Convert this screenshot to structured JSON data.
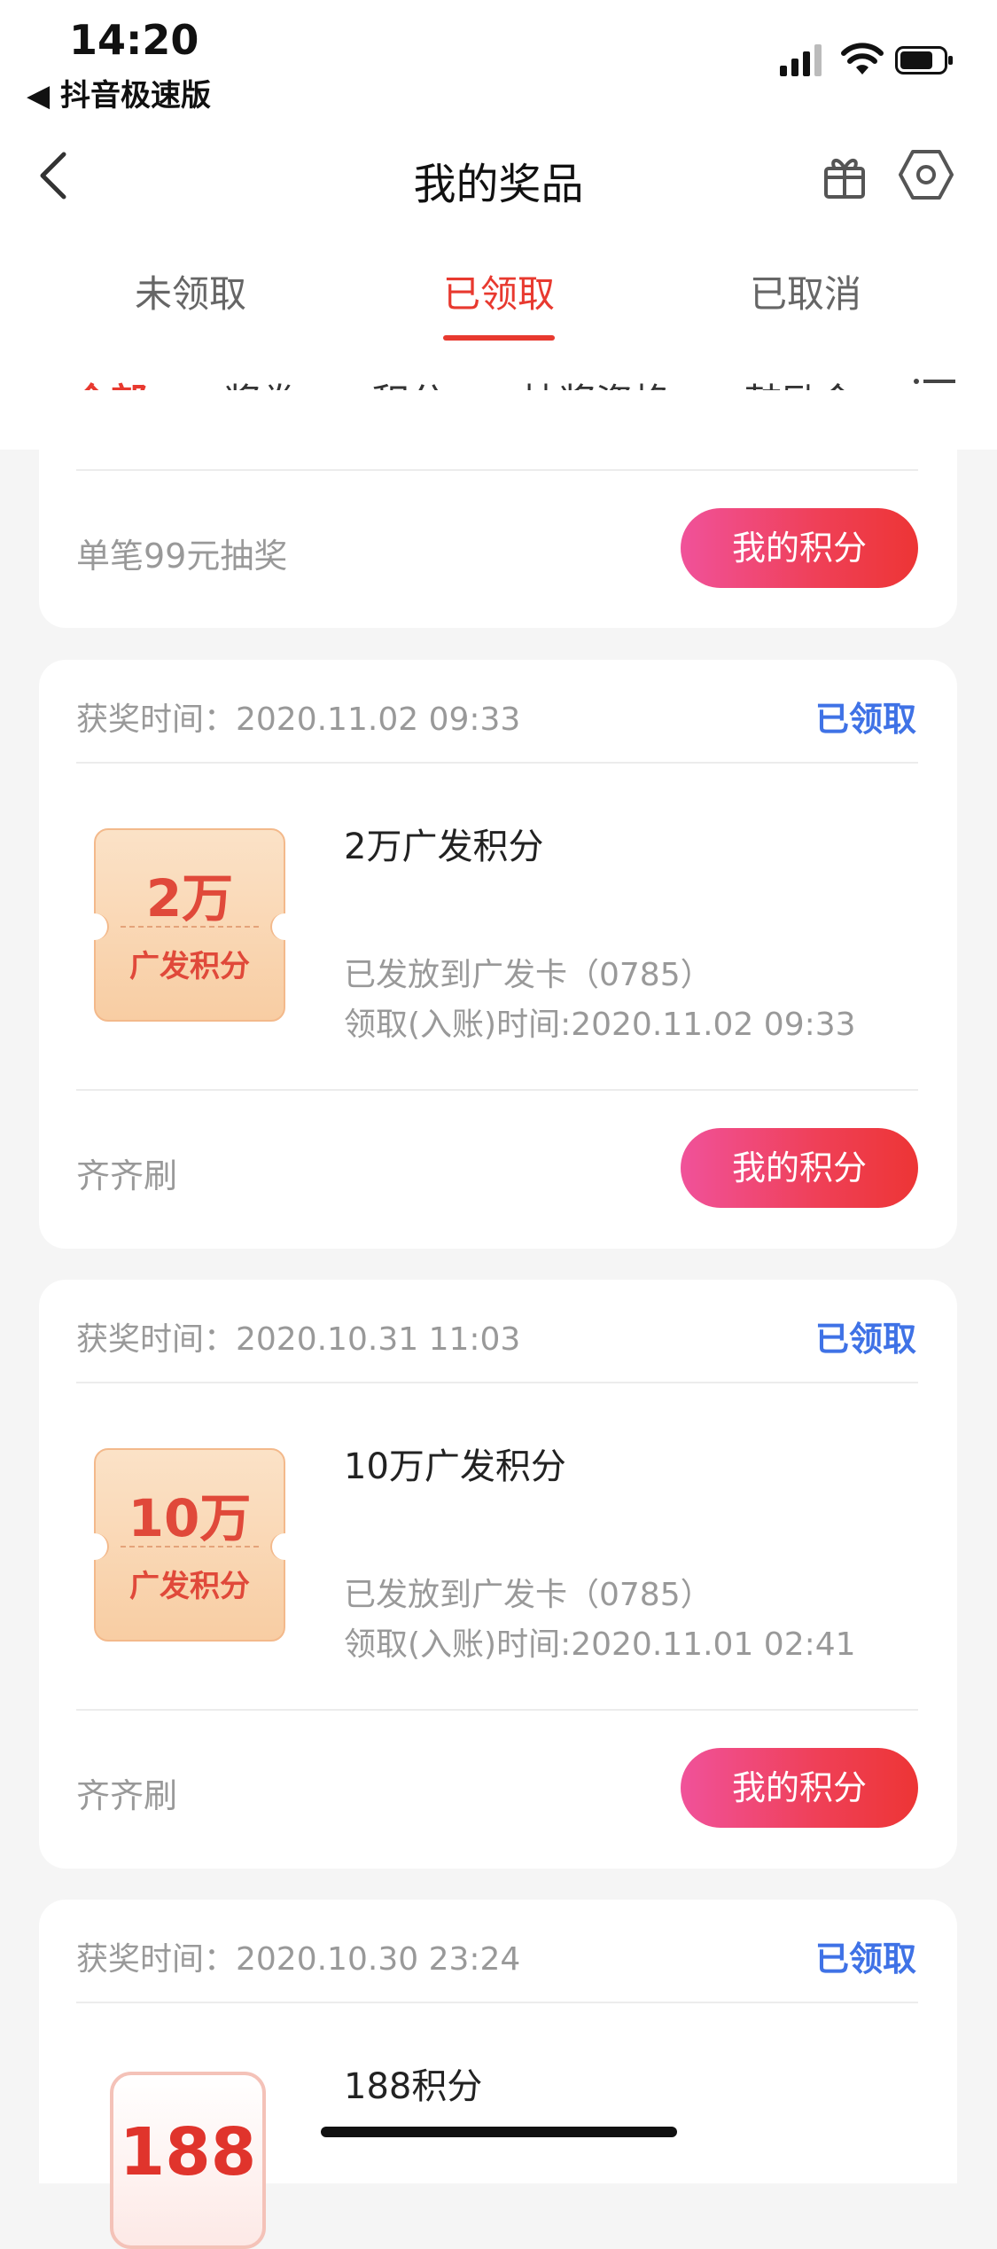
{
  "status_bar": {
    "time": "14:20",
    "back_app": "◀ 抖音极速版"
  },
  "nav": {
    "title": "我的奖品"
  },
  "status_tabs": [
    {
      "label": "未领取",
      "active": false
    },
    {
      "label": "已领取",
      "active": true
    },
    {
      "label": "已取消",
      "active": false
    }
  ],
  "category_tabs": [
    {
      "label": "全部",
      "active": true
    },
    {
      "label": "奖券",
      "active": false
    },
    {
      "label": "积分",
      "active": false
    },
    {
      "label": "抽奖资格",
      "active": false
    },
    {
      "label": "鼓励金",
      "active": false
    }
  ],
  "partial_card": {
    "source": "单笔99元抽奖",
    "action_label": "我的积分"
  },
  "cards": [
    {
      "award_time": "获奖时间：2020.11.02 09:33",
      "status": "已领取",
      "coupon_amount": "2万",
      "coupon_kind": "广发积分",
      "title": "2万广发积分",
      "line1": "已发放到广发卡（0785）",
      "line2": "领取(入账)时间:2020.11.02 09:33",
      "source": "齐齐刷",
      "action_label": "我的积分"
    },
    {
      "award_time": "获奖时间：2020.10.31 11:03",
      "status": "已领取",
      "coupon_amount": "10万",
      "coupon_kind": "广发积分",
      "title": "10万广发积分",
      "line1": "已发放到广发卡（0785）",
      "line2": "领取(入账)时间:2020.11.01 02:41",
      "source": "齐齐刷",
      "action_label": "我的积分"
    },
    {
      "award_time": "获奖时间：2020.10.30 23:24",
      "status": "已领取",
      "image_number": "188",
      "title": "188积分"
    }
  ],
  "colors": {
    "accent": "#e8392f",
    "claimed": "#3f72e6",
    "pill_start": "#f0529a",
    "pill_end": "#ed3535"
  }
}
